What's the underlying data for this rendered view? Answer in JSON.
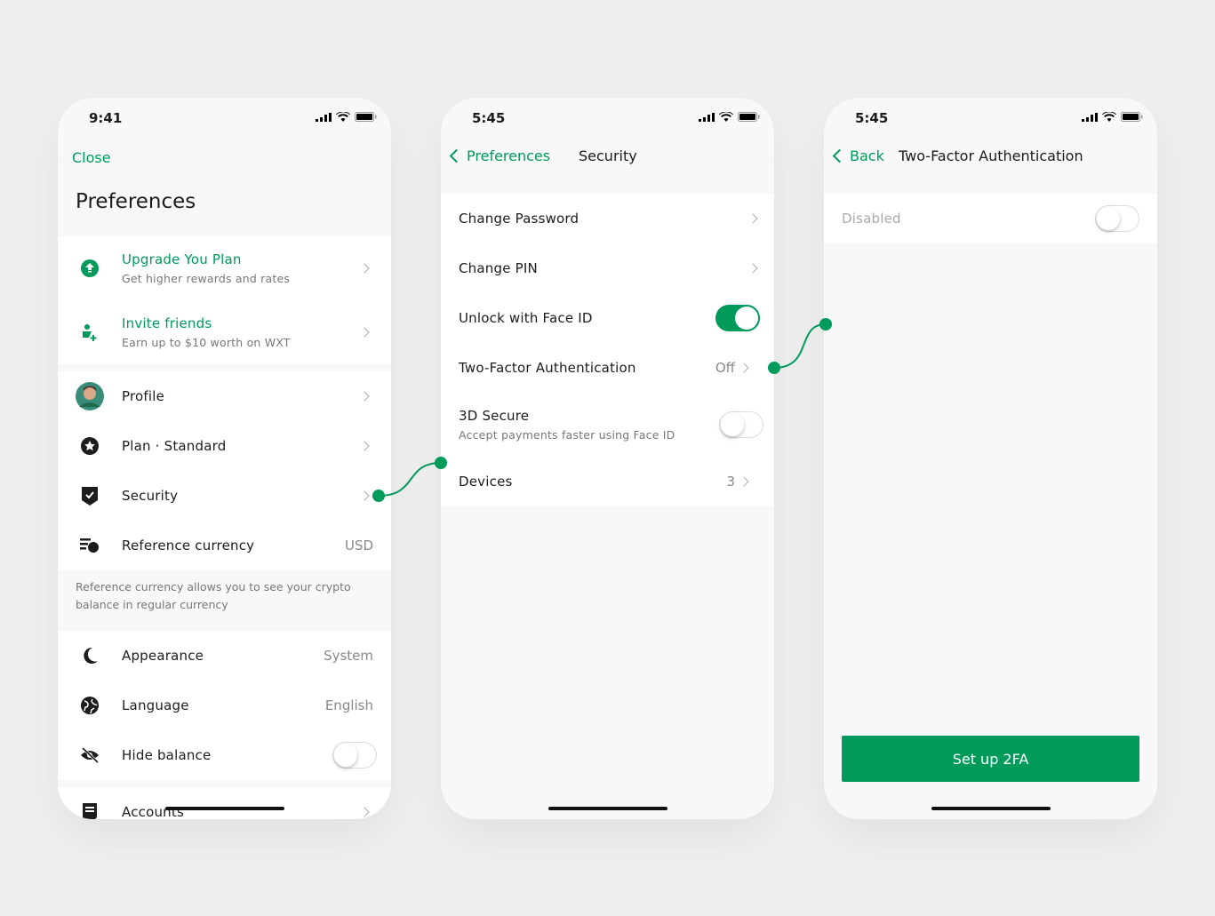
{
  "colors": {
    "accent": "#009a5a",
    "background": "#efefef"
  },
  "screen1": {
    "time": "9:41",
    "close": "Close",
    "title": "Preferences",
    "promo": [
      {
        "icon": "upgrade-icon",
        "title": "Upgrade You Plan",
        "subtitle": "Get higher rewards and rates"
      },
      {
        "icon": "add-user-icon",
        "title": "Invite friends",
        "subtitle": "Earn up to $10 worth on WXT"
      }
    ],
    "items": [
      {
        "icon": "avatar",
        "label": "Profile"
      },
      {
        "icon": "star-icon",
        "label": "Plan · Standard"
      },
      {
        "icon": "shield-check-icon",
        "label": "Security"
      },
      {
        "icon": "currency-icon",
        "label": "Reference currency",
        "value": "USD"
      }
    ],
    "note": "Reference currency allows you to see your crypto balance in regular currency",
    "items2": [
      {
        "icon": "moon-icon",
        "label": "Appearance",
        "value": "System"
      },
      {
        "icon": "globe-icon",
        "label": "Language",
        "value": "English"
      },
      {
        "icon": "eye-off-icon",
        "label": "Hide balance",
        "toggle": false
      }
    ],
    "accounts": "Accounts"
  },
  "screen2": {
    "time": "5:45",
    "back": "Preferences",
    "title": "Security",
    "items": [
      {
        "label": "Change Password"
      },
      {
        "label": "Change PIN"
      },
      {
        "label": "Unlock with Face ID",
        "toggle": true
      },
      {
        "label": "Two-Factor Authentication",
        "value": "Off"
      },
      {
        "label": "3D Secure",
        "subtitle": "Accept payments faster using Face ID",
        "toggle": false
      },
      {
        "label": "Devices",
        "value": "3"
      }
    ]
  },
  "screen3": {
    "time": "5:45",
    "back": "Back",
    "title": "Two-Factor Authentication",
    "status": "Disabled",
    "toggle": false,
    "button": "Set up 2FA"
  }
}
